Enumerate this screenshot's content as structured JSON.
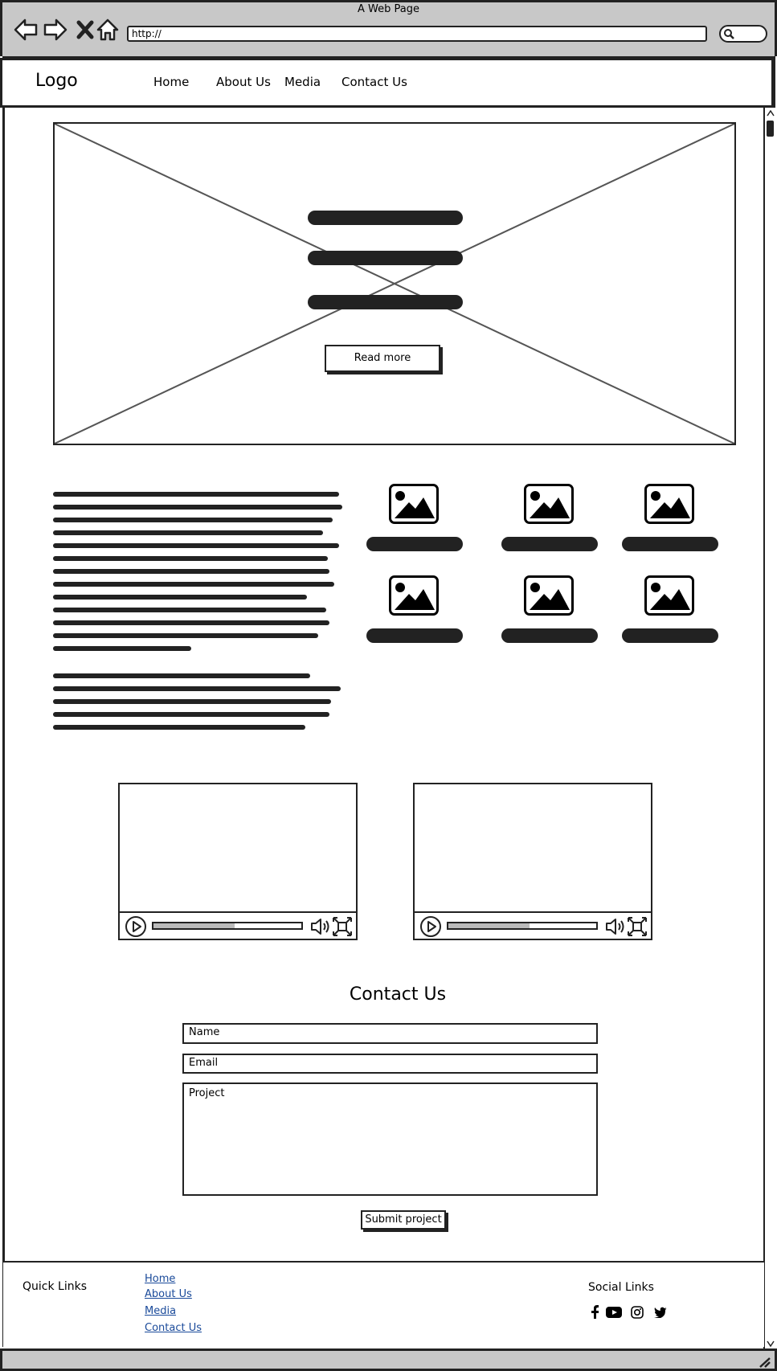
{
  "window": {
    "title": "A Web Page"
  },
  "address_bar": {
    "url": "http://"
  },
  "header": {
    "logo": "Logo",
    "nav": [
      "Home",
      "About Us",
      "Media",
      "Contact Us"
    ]
  },
  "hero": {
    "button_label": "Read more"
  },
  "contact": {
    "title": "Contact Us",
    "name_placeholder": "Name",
    "email_placeholder": "Email",
    "project_placeholder": "Project",
    "submit_label": "Submit project"
  },
  "footer": {
    "quick_links_title": "Quick Links",
    "quick_links": [
      "Home",
      "About Us",
      "Media",
      "Contact Us"
    ],
    "social_title": "Social Links",
    "social_icons": [
      "facebook-icon",
      "youtube-icon",
      "instagram-icon",
      "twitter-icon"
    ]
  },
  "videos": [
    {
      "progress": 0.55
    },
    {
      "progress": 0.55
    }
  ]
}
